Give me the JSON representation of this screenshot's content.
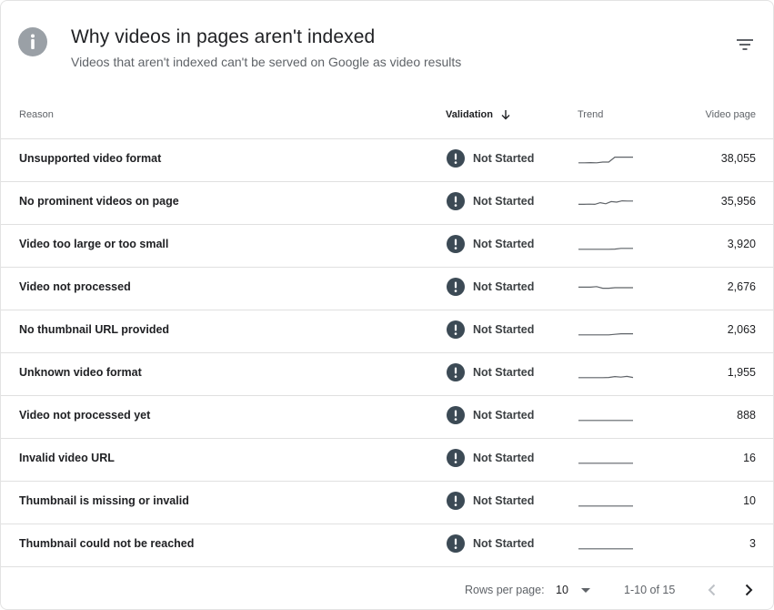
{
  "header": {
    "title": "Why videos in pages aren't indexed",
    "subtitle": "Videos that aren't indexed can't be served on Google as video results",
    "icon": "info-icon",
    "filter_icon": "filter-icon"
  },
  "table": {
    "columns": {
      "reason": "Reason",
      "validation": "Validation",
      "trend": "Trend",
      "pages": "Video page"
    },
    "sort_icon": "arrow-down-icon",
    "rows": [
      {
        "reason": "Unsupported video format",
        "status": "Not Started",
        "pages": "38,055",
        "trend": [
          0.18,
          0.18,
          0.2,
          0.18,
          0.25,
          0.25,
          0.7,
          0.7,
          0.7,
          0.7
        ]
      },
      {
        "reason": "No prominent videos on page",
        "status": "Not Started",
        "pages": "35,956",
        "trend": [
          0.3,
          0.3,
          0.32,
          0.3,
          0.45,
          0.35,
          0.55,
          0.5,
          0.62,
          0.6,
          0.6
        ]
      },
      {
        "reason": "Video too large or too small",
        "status": "Not Started",
        "pages": "3,920",
        "trend": [
          0.1,
          0.1,
          0.1,
          0.1,
          0.1,
          0.1,
          0.12,
          0.18,
          0.18,
          0.18
        ]
      },
      {
        "reason": "Video not processed",
        "status": "Not Started",
        "pages": "2,676",
        "trend": [
          0.55,
          0.55,
          0.55,
          0.6,
          0.45,
          0.45,
          0.5,
          0.5,
          0.5,
          0.5
        ]
      },
      {
        "reason": "No thumbnail URL provided",
        "status": "Not Started",
        "pages": "2,063",
        "trend": [
          0.1,
          0.1,
          0.1,
          0.1,
          0.1,
          0.1,
          0.15,
          0.2,
          0.2,
          0.2
        ]
      },
      {
        "reason": "Unknown video format",
        "status": "Not Started",
        "pages": "1,955",
        "trend": [
          0.1,
          0.1,
          0.1,
          0.1,
          0.1,
          0.12,
          0.2,
          0.15,
          0.22,
          0.12
        ]
      },
      {
        "reason": "Video not processed yet",
        "status": "Not Started",
        "pages": "888",
        "trend": [
          0.1,
          0.1,
          0.1,
          0.1,
          0.1,
          0.1,
          0.1,
          0.1,
          0.1,
          0.1
        ]
      },
      {
        "reason": "Invalid video URL",
        "status": "Not Started",
        "pages": "16",
        "trend": [
          0.1,
          0.1,
          0.1,
          0.1,
          0.1,
          0.1,
          0.1,
          0.1,
          0.1,
          0.1
        ]
      },
      {
        "reason": "Thumbnail is missing or invalid",
        "status": "Not Started",
        "pages": "10",
        "trend": [
          0.1,
          0.1,
          0.1,
          0.1,
          0.1,
          0.1,
          0.1,
          0.1,
          0.1,
          0.1
        ]
      },
      {
        "reason": "Thumbnail could not be reached",
        "status": "Not Started",
        "pages": "3",
        "trend": [
          0.1,
          0.1,
          0.1,
          0.1,
          0.1,
          0.1,
          0.1,
          0.1,
          0.1,
          0.1
        ]
      }
    ]
  },
  "footer": {
    "rows_per_page_label": "Rows per page:",
    "rows_per_page_value": "10",
    "range": "1-10 of 15",
    "prev_icon": "chevron-left-icon",
    "next_icon": "chevron-right-icon"
  },
  "colors": {
    "info_icon_bg": "#9aa0a6",
    "status_icon_bg": "#3c4a55",
    "divider": "#e0e0e0",
    "trend_line": "#5f6368"
  }
}
